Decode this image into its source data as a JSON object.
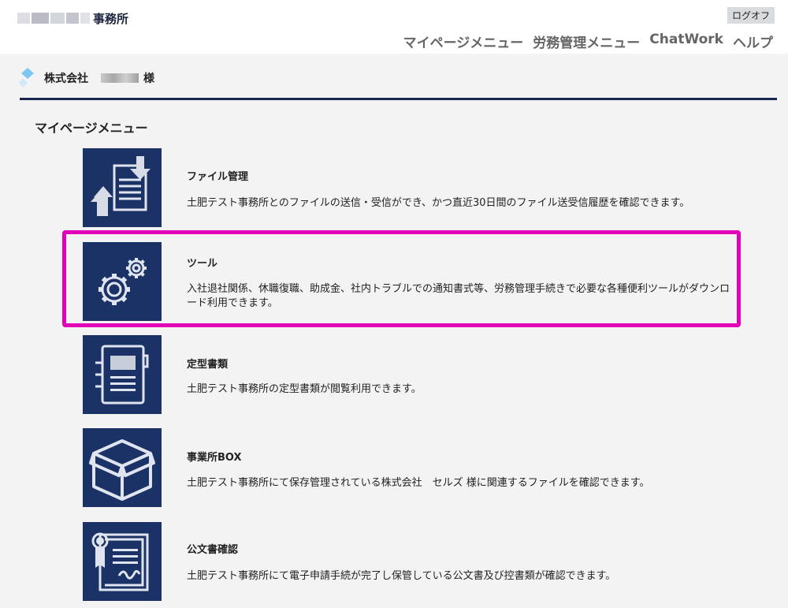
{
  "header": {
    "office_name": "事務所",
    "logout_label": "ログオフ",
    "nav": [
      "マイページメニュー",
      "労務管理メニュー",
      "ChatWork",
      "ヘルプ"
    ]
  },
  "company": {
    "prefix": "株式会社",
    "suffix": "様"
  },
  "section_title": "マイページメニュー",
  "items": [
    {
      "title": "ファイル管理",
      "description": "土肥テスト事務所とのファイルの送信・受信ができ、かつ直近30日間のファイル送受信履歴を確認できます。",
      "icon": "file-transfer-icon"
    },
    {
      "title": "ツール",
      "description": "入社退社関係、休職復職、助成金、社内トラブルでの通知書式等、労務管理手続きで必要な各種便利ツールがダウンロード利用できます。",
      "icon": "gears-icon"
    },
    {
      "title": "定型書類",
      "description": "土肥テスト事務所の定型書類が閲覧利用できます。",
      "icon": "notebook-icon"
    },
    {
      "title": "事業所BOX",
      "description": "土肥テスト事務所にて保存管理されている株式会社　セルズ 様に関連するファイルを確認できます。",
      "icon": "box-icon"
    },
    {
      "title": "公文書確認",
      "description": "土肥テスト事務所にて電子申請手続が完了し保管している公文書及び控書類が確認できます。",
      "icon": "certificate-icon"
    }
  ],
  "colors": {
    "tile": "#1b3266",
    "highlight": "#e100b8",
    "rule": "#1a2550",
    "background": "#f3f3f3"
  }
}
